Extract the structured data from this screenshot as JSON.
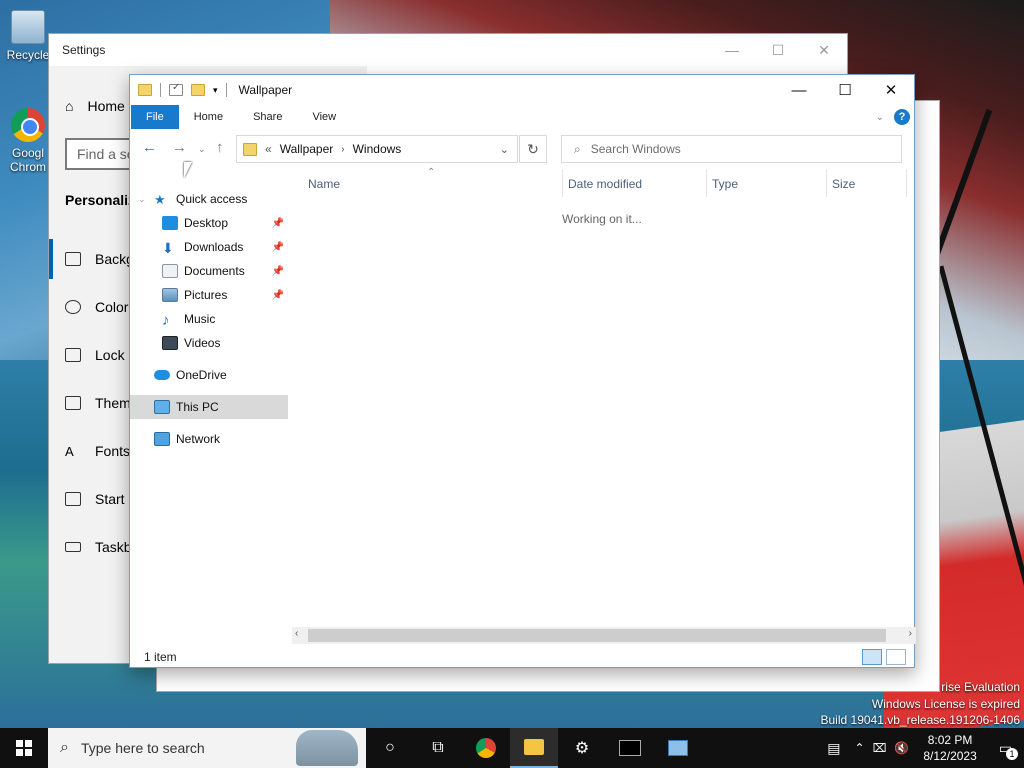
{
  "desktop": {
    "icons": [
      {
        "label": "Recycle",
        "icon": "recycle-bin-icon"
      },
      {
        "label": "Googl Chrom",
        "icon": "chrome-icon"
      }
    ],
    "watermark": {
      "line1": "rise Evaluation",
      "line2": "Windows License is expired",
      "line3": "Build 19041.vb_release.191206-1406"
    }
  },
  "settings": {
    "title": "Settings",
    "home": "Home",
    "search_placeholder": "Find a se",
    "section": "Personaliz",
    "nav": [
      "Backg",
      "Color",
      "Lock s",
      "Them",
      "Fonts",
      "Start",
      "Taskb"
    ]
  },
  "explorer": {
    "title": "Wallpaper",
    "ribbon_tabs": [
      "File",
      "Home",
      "Share",
      "View"
    ],
    "address": {
      "overflow": "«",
      "crumbs": [
        "Wallpaper",
        "Windows"
      ]
    },
    "search_placeholder": "Search Windows",
    "nav_pane": {
      "quick_access": "Quick access",
      "items": [
        "Desktop",
        "Downloads",
        "Documents",
        "Pictures",
        "Music",
        "Videos"
      ],
      "onedrive": "OneDrive",
      "this_pc": "This PC",
      "network": "Network"
    },
    "columns": [
      "Name",
      "Date modified",
      "Type",
      "Size"
    ],
    "status_message": "Working on it...",
    "status_bar": "1 item"
  },
  "taskbar": {
    "search_placeholder": "Type here to search",
    "time": "8:02 PM",
    "date": "8/12/2023",
    "notification_count": "1"
  }
}
